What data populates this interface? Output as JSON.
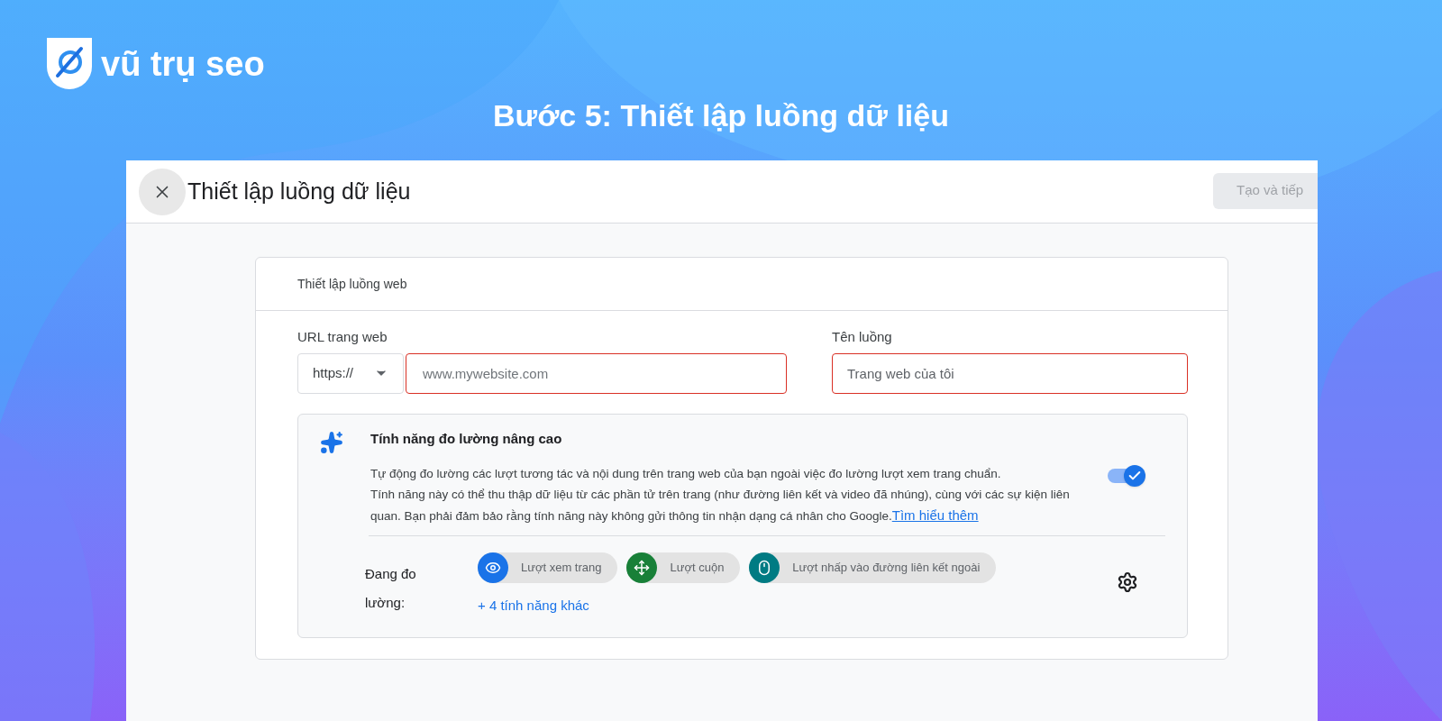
{
  "brand": {
    "name": "vũ trụ seo"
  },
  "heading": "Bước 5: Thiết lập luồng dữ liệu",
  "dialog": {
    "title": "Thiết lập luồng dữ liệu",
    "primary_button": {
      "label": "Tạo và tiếp",
      "disabled": true
    }
  },
  "card": {
    "title": "Thiết lập luồng web",
    "url_field": {
      "label": "URL trang web",
      "protocol": "https://",
      "placeholder": "www.mywebsite.com"
    },
    "name_field": {
      "label": "Tên luồng",
      "placeholder": "Trang web của tôi"
    },
    "enhanced": {
      "title": "Tính năng đo lường nâng cao",
      "description": [
        "Tự động đo lường các lượt tương tác và nội dung trên trang web của bạn ngoài việc đo lường lượt xem trang chuẩn.",
        "Tính năng này có thể thu thập dữ liệu từ các phần tử trên trang (như đường liên kết và video đã nhúng), cùng với các sự kiện liên quan. Bạn phải đảm bảo rằng tính năng này không gửi thông tin nhận dạng cá nhân cho Google."
      ],
      "link": "Tìm hiểu thêm",
      "on": true,
      "measuring_label": "Đang đo lường:",
      "chips": [
        {
          "kind": "eye",
          "label": "Lượt xem trang",
          "color": "#1a73e8"
        },
        {
          "kind": "move",
          "label": "Lượt cuộn",
          "color": "#188038"
        },
        {
          "kind": "mouse",
          "label": "Lượt nhấp vào đường liên kết ngoài",
          "color": "#007b83"
        }
      ],
      "more_link": "+ 4 tính năng khác"
    }
  }
}
